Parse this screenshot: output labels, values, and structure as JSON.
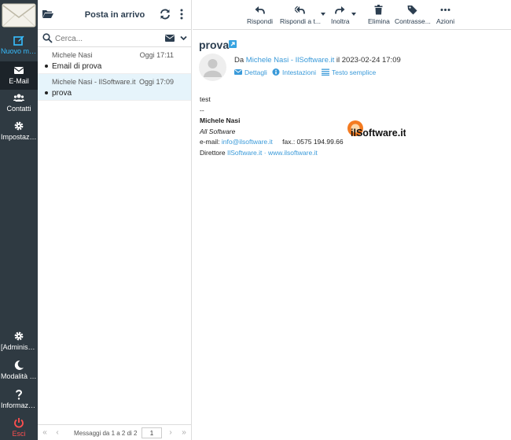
{
  "nav": {
    "items": [
      {
        "label": "Nuovo mes...",
        "icon": "compose-icon"
      },
      {
        "label": "E-Mail",
        "icon": "envelope-icon"
      },
      {
        "label": "Contatti",
        "icon": "contacts-icon"
      },
      {
        "label": "Impostazioni",
        "icon": "gear-icon"
      },
      {
        "label": "[Administra...",
        "icon": "gear-icon"
      },
      {
        "label": "Modalità sc...",
        "icon": "moon-icon"
      },
      {
        "label": "Informazioni",
        "icon": "question-icon"
      },
      {
        "label": "Esci",
        "icon": "power-icon"
      }
    ]
  },
  "list": {
    "title": "Posta in arrivo",
    "search_placeholder": "Cerca...",
    "messages": [
      {
        "from": "Michele Nasi",
        "date": "Oggi 17:11",
        "subject": "Email di prova"
      },
      {
        "from": "Michele Nasi - IlSoftware.it",
        "date": "Oggi 17:09",
        "subject": "prova"
      }
    ],
    "pager_text": "Messaggi da 1 a 2 di 2",
    "page": "1"
  },
  "toolbar": {
    "reply": "Rispondi",
    "reply_all": "Rispondi a t...",
    "forward": "Inoltra",
    "delete": "Elimina",
    "mark": "Contrasse...",
    "more": "Azioni"
  },
  "message": {
    "subject": "prova",
    "from_prefix": "Da",
    "from_name": "Michele Nasi - IlSoftware.it",
    "date_text": "il 2023-02-24 17:09",
    "links": {
      "details": "Dettagli",
      "headers": "Intestazioni",
      "plain": "Testo semplice"
    },
    "body_text": "test",
    "sig_dashes": "--",
    "sig_name": "Michele Nasi",
    "sig_company": "All Software",
    "sig_email_label": "e-mail:",
    "sig_email": "info@ilsoftware.it",
    "sig_fax": "fax.: 0575 194.99.66",
    "sig_director_label": "Direttore",
    "sig_director_link1": "IlSoftware.it",
    "sig_director_sep": "·",
    "sig_director_link2": "www.ilsoftware.it",
    "logo_text": "ilSoftware.it"
  },
  "colors": {
    "nav_bg": "#2f3a42",
    "accent": "#37beff",
    "link": "#3a9ad9",
    "logout": "#ff4f4f",
    "selected_bg": "#e6f4fb"
  }
}
